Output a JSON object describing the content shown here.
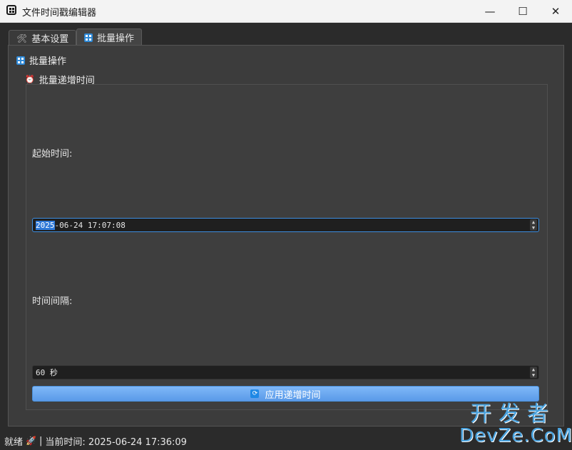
{
  "window": {
    "title": "文件时间戳编辑器",
    "minimize": "—",
    "maximize": "☐",
    "close": "✕"
  },
  "tabs": [
    {
      "label": "基本设置",
      "icon": "tools-icon",
      "active": false
    },
    {
      "label": "批量操作",
      "icon": "grid-icon",
      "active": true
    }
  ],
  "batch": {
    "group_title": "批量操作",
    "sub_group_title": "批量递增时间",
    "start_label": "起始时间:",
    "start_value_selected": "2025",
    "start_value_rest": "-06-24 17:07:08",
    "interval_label": "时间间隔:",
    "interval_value": "60 秒",
    "apply_button": "应用递增时间"
  },
  "status": {
    "ready": "就绪",
    "separator": "|",
    "current_time": "当前时间: 2025-06-24 17:36:09"
  },
  "watermark": {
    "top": "开发者",
    "bottom": "DevZe.CoM"
  },
  "colors": {
    "accent": "#3d8ee0",
    "button": "#6aa8f0",
    "background": "#3c3c3c"
  }
}
